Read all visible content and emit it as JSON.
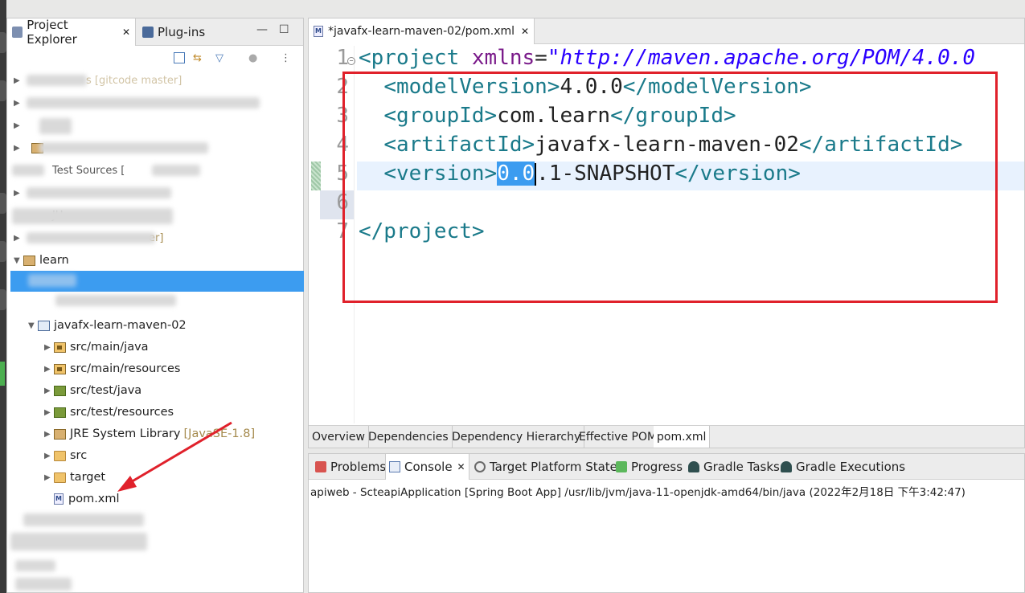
{
  "explorer": {
    "tab_label": "Project Explorer",
    "plugins_label": "Plug-ins",
    "tree": {
      "redacted_fragments": [
        "s [gitcode master]",
        "Test Sources [",
        "JU",
        "er]"
      ],
      "learn_label": "learn",
      "project_label": "javafx-learn-maven-02",
      "children": [
        {
          "label": "src/main/java",
          "icon": "source-folder-icon"
        },
        {
          "label": "src/main/resources",
          "icon": "source-folder-icon"
        },
        {
          "label": "src/test/java",
          "icon": "test-source-folder-icon"
        },
        {
          "label": "src/test/resources",
          "icon": "test-source-folder-icon"
        },
        {
          "label": "JRE System Library",
          "decoration": "[JavaSE-1.8]",
          "icon": "library-icon"
        },
        {
          "label": "src",
          "icon": "folder-icon"
        },
        {
          "label": "target",
          "icon": "folder-icon"
        },
        {
          "label": "pom.xml",
          "icon": "maven-file-icon"
        }
      ]
    }
  },
  "editor": {
    "tab_label": "*javafx-learn-maven-02/pom.xml",
    "lines": [
      {
        "num": "1",
        "open": "<project",
        "attr": "xmlns",
        "eq": "=",
        "value": "\"http://maven.apache.org/POM/4.0.0"
      },
      {
        "num": "2",
        "open_tag": "<modelVersion>",
        "text": "4.0.0",
        "close_tag": "</modelVersion>"
      },
      {
        "num": "3",
        "open_tag": "<groupId>",
        "text": "com.learn",
        "close_tag": "</groupId>"
      },
      {
        "num": "4",
        "open_tag": "<artifactId>",
        "text": "javafx-learn-maven-02",
        "close_tag": "</artifactId>"
      },
      {
        "num": "5",
        "open_tag": "<version>",
        "selected": "0.0",
        "text": ".1-SNAPSHOT",
        "close_tag": "</version>"
      },
      {
        "num": "6"
      },
      {
        "num": "7",
        "close_tag": "</project>"
      }
    ],
    "bottom_tabs": [
      "Overview",
      "Dependencies",
      "Dependency Hierarchy",
      "Effective POM",
      "pom.xml"
    ],
    "active_bottom_tab": "pom.xml"
  },
  "console": {
    "tabs": [
      {
        "label": "Problems",
        "icon": "problems-icon"
      },
      {
        "label": "Console",
        "icon": "console-icon"
      },
      {
        "label": "Target Platform State",
        "icon": "target-platform-icon"
      },
      {
        "label": "Progress",
        "icon": "progress-icon"
      },
      {
        "label": "Gradle Tasks",
        "icon": "gradle-icon"
      },
      {
        "label": "Gradle Executions",
        "icon": "gradle-icon"
      }
    ],
    "info": "apiweb - ScteapiApplication [Spring Boot App] /usr/lib/jvm/java-11-openjdk-amd64/bin/java  (2022年2月18日 下午3:42:47)"
  },
  "colors": {
    "selection": "#3c9cf0",
    "annotation": "#e0212b",
    "tag": "#1a7a8a",
    "attr": "#7a1a8a",
    "string": "#2a00ff"
  }
}
